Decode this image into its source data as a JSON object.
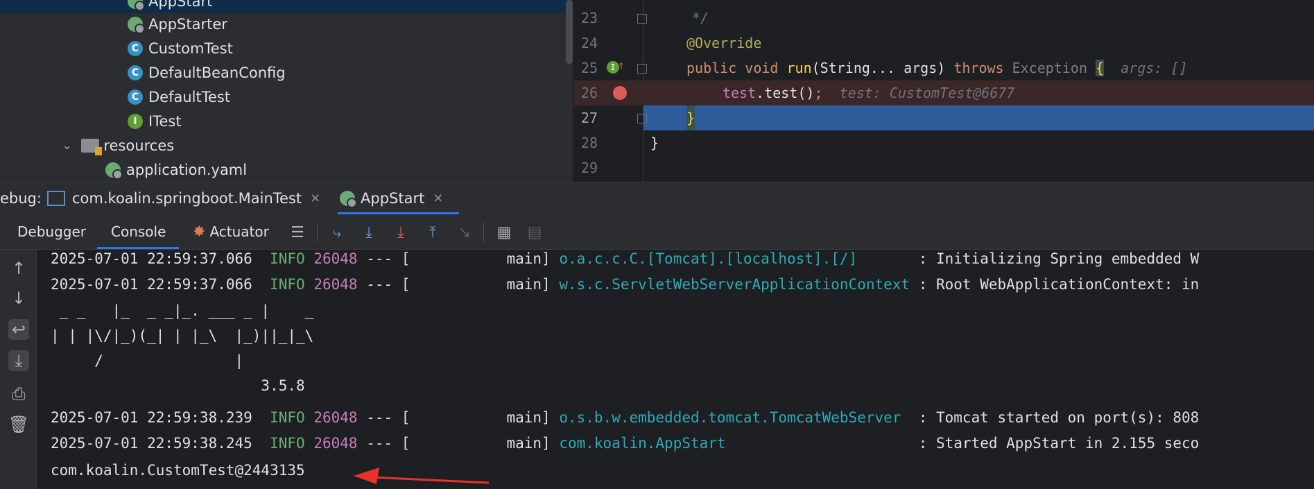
{
  "project_tree": {
    "items": [
      {
        "label": "AppStart",
        "icon": "spring-boot-icon"
      },
      {
        "label": "AppStarter",
        "icon": "spring-boot-icon"
      },
      {
        "label": "CustomTest",
        "icon": "class-icon"
      },
      {
        "label": "DefaultBeanConfig",
        "icon": "class-icon"
      },
      {
        "label": "DefaultTest",
        "icon": "class-icon"
      },
      {
        "label": "ITest",
        "icon": "interface-icon"
      },
      {
        "label": "resources",
        "icon": "folder-icon"
      },
      {
        "label": "application.yaml",
        "icon": "spring-config-icon"
      }
    ],
    "class_glyph": "C",
    "interface_glyph": "I"
  },
  "editor": {
    "line_numbers": [
      "23",
      "24",
      "25",
      "26",
      "27",
      "28",
      "29"
    ],
    "line23": "*/",
    "line24": "@Override",
    "line25": {
      "kw1": "public",
      "kw2": "void",
      "method": "run",
      "params": "(String... args) ",
      "throws": "throws",
      "exc": " Exception ",
      "brace": "{",
      "hint": "args: []"
    },
    "line26": {
      "obj": "test",
      "call": ".test()",
      "semi": ";",
      "hint": "test: CustomTest@6677"
    },
    "line27": "}",
    "line28": "}"
  },
  "debug": {
    "label": "ebug:",
    "tabs": [
      {
        "label": "com.koalin.springboot.MainTest",
        "close": "✕"
      },
      {
        "label": "AppStart",
        "close": "✕"
      }
    ]
  },
  "toolbar": {
    "tabs": [
      "Debugger",
      "Console",
      "Actuator"
    ],
    "active_tab": "Console"
  },
  "console": {
    "lines": [
      {
        "ts": "2025-07-01 22:59:37.066",
        "level": "INFO",
        "pid": "26048",
        "sep": " --- [",
        "thread": "           main] ",
        "logger": "o.a.c.c.C.[Tomcat].[localhost].[/]      ",
        "msg": " : Initializing Spring embedded W"
      },
      {
        "ts": "2025-07-01 22:59:37.066",
        "level": "INFO",
        "pid": "26048",
        "sep": " --- [",
        "thread": "           main] ",
        "logger": "w.s.c.ServletWebServerApplicationContext",
        "msg": " : Root WebApplicationContext: in"
      },
      {
        "ts": "2025-07-01 22:59:38.239",
        "level": "INFO",
        "pid": "26048",
        "sep": " --- [",
        "thread": "           main] ",
        "logger": "o.s.b.w.embedded.tomcat.TomcatWebServer ",
        "msg": " : Tomcat started on port(s): 808"
      },
      {
        "ts": "2025-07-01 22:59:38.245",
        "level": "INFO",
        "pid": "26048",
        "sep": " --- [",
        "thread": "           main] ",
        "logger": "com.koalin.AppStart                     ",
        "msg": " : Started AppStart in 2.155 seco"
      }
    ],
    "banner": [
      " _ _   |_  _ _|_. ___ _ |    _",
      "| | |\\/|_)(_| | |_\\  |_)||_|_\\",
      "     /               |",
      "                        3.5.8"
    ],
    "output": "com.koalin.CustomTest@2443135"
  },
  "colors": {
    "arrow": "#e8322a",
    "selection": "#2e5c9b",
    "breakpoint_line": "#3b2628"
  }
}
